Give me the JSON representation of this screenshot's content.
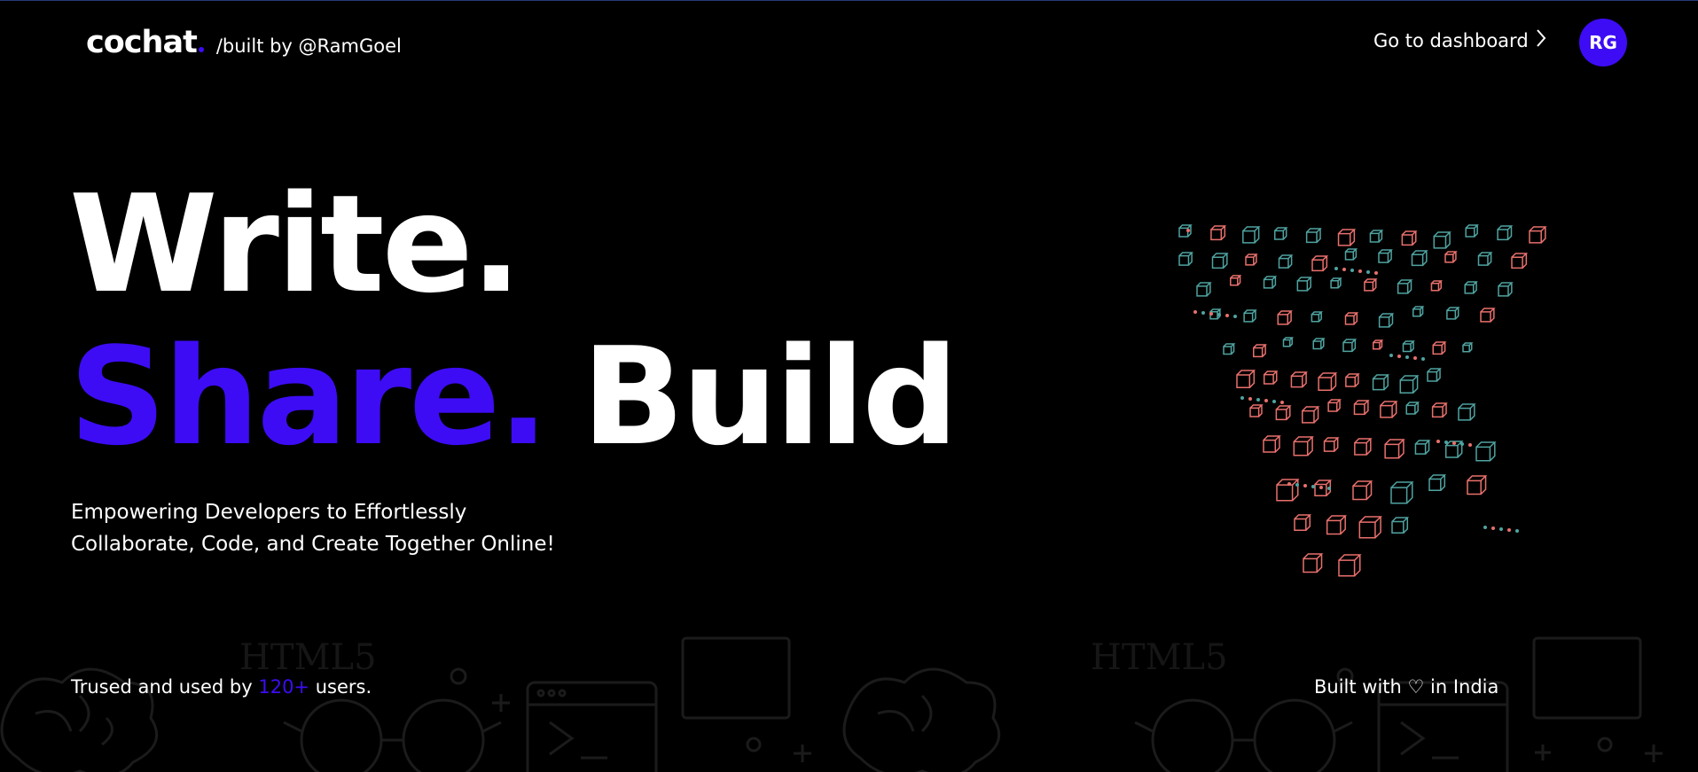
{
  "header": {
    "logo_text": "cochat",
    "byline": "/built by @RamGoel",
    "dashboard_label": "Go to dashboard",
    "avatar_initials": "RG"
  },
  "hero": {
    "line1": "Write.",
    "line2a": "Share.",
    "line2b": "Build",
    "tagline_line1": "Empowering Developers to Effortlessly",
    "tagline_line2": "Collaborate, Code, and Create Together Online!"
  },
  "footer": {
    "trust_prefix": "Trused and used by ",
    "trust_count": "120+",
    "trust_suffix": " users.",
    "made_prefix": "Built with ",
    "made_suffix": " in India"
  },
  "decor_text": "HTML5",
  "colors": {
    "accent": "#3d0cf5",
    "background": "#000000",
    "text": "#ffffff",
    "cube_coral": "#e8706c",
    "cube_teal": "#4fa3a0"
  },
  "icons": {
    "chevron": "chevron-right-icon",
    "heart": "heart-icon",
    "logo_dot": "logo-dot-icon",
    "illustration": "cube-funnel-illustration"
  }
}
